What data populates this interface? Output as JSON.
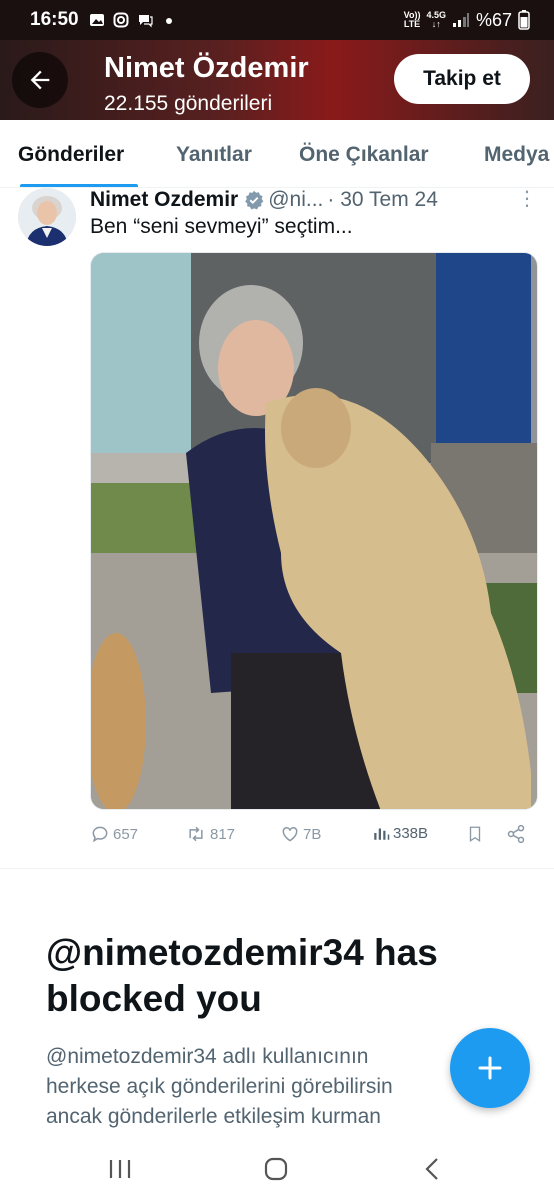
{
  "status_bar": {
    "time": "16:50",
    "network_top": "Vo))",
    "network_bottom": "LTE",
    "network_gen": "4.5G",
    "battery": "%67"
  },
  "header": {
    "name": "Nimet Özdemir",
    "post_count": "22.155 gönderileri",
    "follow_label": "Takip et"
  },
  "tabs": [
    {
      "label": "Gönderiler",
      "active": true
    },
    {
      "label": "Yanıtlar",
      "active": false
    },
    {
      "label": "Öne Çıkanlar",
      "active": false
    },
    {
      "label": "Medya",
      "active": false
    }
  ],
  "tweet": {
    "name": "Nimet Ozdemir",
    "handle": "@ni...",
    "date": "· 30 Tem 24",
    "text": "Ben “seni sevmeyi” seçtim...",
    "replies": "657",
    "reposts": "817",
    "likes": "7B",
    "views": "338B"
  },
  "blocked": {
    "title": "@nimetozdemir34 has blocked you",
    "description": "@nimetozdemir34 adlı kullanıcının herkese açık gönderilerini görebilirsin ancak gönderilerle etkileşim kurman"
  },
  "colors": {
    "accent": "#1d9bf0",
    "text_primary": "#0f1419",
    "text_secondary": "#536471"
  },
  "icons": [
    "back-arrow-icon",
    "verified-badge-icon",
    "more-icon",
    "reply-icon",
    "repost-icon",
    "like-icon",
    "views-icon",
    "bookmark-icon",
    "share-icon",
    "plus-icon",
    "recent-apps-icon",
    "home-icon",
    "back-icon"
  ]
}
